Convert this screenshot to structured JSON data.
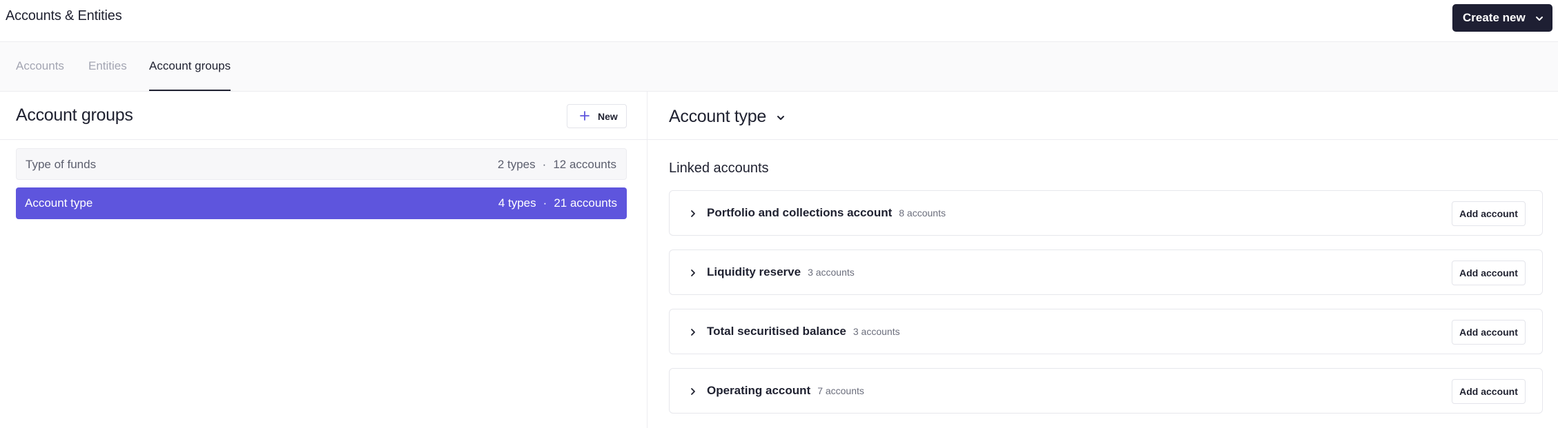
{
  "header": {
    "title": "Accounts & Entities",
    "create_label": "Create new",
    "create_icon": "chevron-down-icon"
  },
  "tabs": [
    {
      "label": "Accounts",
      "active": false
    },
    {
      "label": "Entities",
      "active": false
    },
    {
      "label": "Account groups",
      "active": true
    }
  ],
  "left_panel": {
    "title": "Account groups",
    "new_label": "New",
    "new_icon": "plus-icon",
    "groups": [
      {
        "name": "Type of funds",
        "types": "2 types",
        "accounts": "12 accounts",
        "selected": false
      },
      {
        "name": "Account type",
        "types": "4 types",
        "accounts": "21 accounts",
        "selected": true
      }
    ],
    "separator": "·"
  },
  "right_panel": {
    "title": "Account type",
    "title_icon": "chevron-down-icon",
    "linked_title": "Linked accounts",
    "add_label": "Add account",
    "accounts": [
      {
        "name": "Portfolio and collections account",
        "count": "8 accounts"
      },
      {
        "name": "Liquidity reserve",
        "count": "3 accounts"
      },
      {
        "name": "Total securitised balance",
        "count": "3 accounts"
      },
      {
        "name": "Operating account",
        "count": "7 accounts"
      }
    ]
  },
  "colors": {
    "accent": "#5e55dd",
    "dark_button": "#1e1f33",
    "text": "#1f2130",
    "muted_tab": "#a3a5b2"
  }
}
